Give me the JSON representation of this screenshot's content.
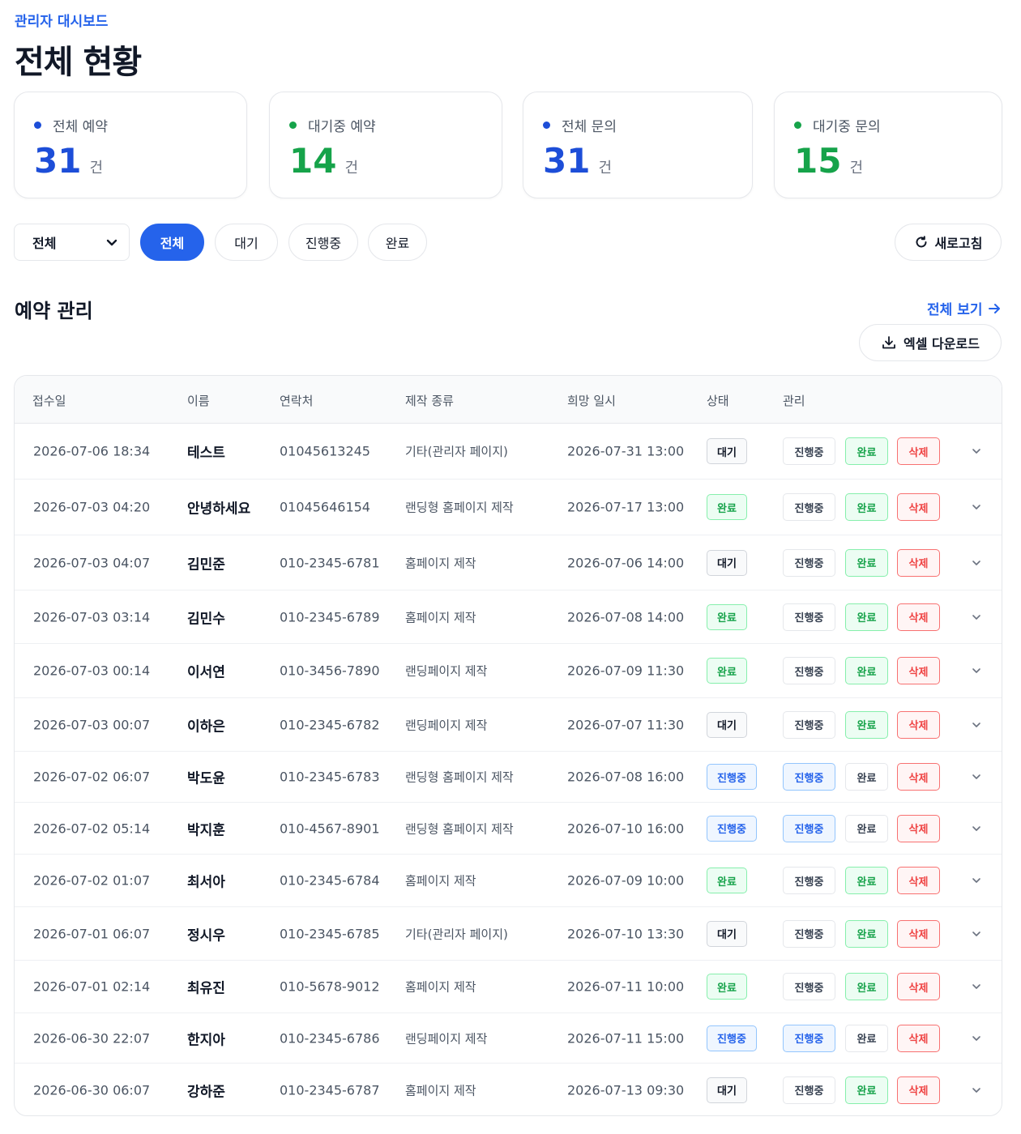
{
  "header": {
    "eyebrow": "관리자 대시보드",
    "title": "전체 현황"
  },
  "stats": [
    {
      "label": "전체 예약",
      "value": "31",
      "unit": "건",
      "color": "#1d4ed8"
    },
    {
      "label": "대기중 예약",
      "value": "14",
      "unit": "건",
      "color": "#16a34a"
    },
    {
      "label": "전체 문의",
      "value": "31",
      "unit": "건",
      "color": "#1d4ed8"
    },
    {
      "label": "대기중 문의",
      "value": "15",
      "unit": "건",
      "color": "#16a34a"
    }
  ],
  "filters": {
    "select_value": "전체",
    "pills": [
      "전체",
      "대기",
      "진행중",
      "완료"
    ],
    "active_pill": "전체",
    "refresh_label": "새로고침"
  },
  "section": {
    "title": "예약 관리",
    "view_all": "전체 보기",
    "excel_label": "엑셀 다운로드"
  },
  "table": {
    "columns": [
      "접수일",
      "이름",
      "연락처",
      "제작 종류",
      "희망 일시",
      "상태",
      "관리"
    ],
    "actions": {
      "progress": "진행중",
      "done": "완료",
      "delete": "삭제"
    },
    "rows": [
      {
        "date": "2026-07-06 18:34",
        "name": "테스트",
        "phone": "01045613245",
        "type": "기타(관리자 페이지)",
        "wish": "2026-07-31 13:00",
        "status": "대기",
        "status_key": "wait"
      },
      {
        "date": "2026-07-03 04:20",
        "name": "안녕하세요",
        "phone": "01045646154",
        "type": "랜딩형 홈페이지 제작",
        "wish": "2026-07-17 13:00",
        "status": "완료",
        "status_key": "done"
      },
      {
        "date": "2026-07-03 04:07",
        "name": "김민준",
        "phone": "010-2345-6781",
        "type": "홈페이지 제작",
        "wish": "2026-07-06 14:00",
        "status": "대기",
        "status_key": "wait"
      },
      {
        "date": "2026-07-03 03:14",
        "name": "김민수",
        "phone": "010-2345-6789",
        "type": "홈페이지 제작",
        "wish": "2026-07-08 14:00",
        "status": "완료",
        "status_key": "done"
      },
      {
        "date": "2026-07-03 00:14",
        "name": "이서연",
        "phone": "010-3456-7890",
        "type": "랜딩페이지 제작",
        "wish": "2026-07-09 11:30",
        "status": "완료",
        "status_key": "done"
      },
      {
        "date": "2026-07-03 00:07",
        "name": "이하은",
        "phone": "010-2345-6782",
        "type": "랜딩페이지 제작",
        "wish": "2026-07-07 11:30",
        "status": "대기",
        "status_key": "wait"
      },
      {
        "date": "2026-07-02 06:07",
        "name": "박도윤",
        "phone": "010-2345-6783",
        "type": "랜딩형 홈페이지 제작",
        "wish": "2026-07-08 16:00",
        "status": "진행중",
        "status_key": "prog"
      },
      {
        "date": "2026-07-02 05:14",
        "name": "박지훈",
        "phone": "010-4567-8901",
        "type": "랜딩형 홈페이지 제작",
        "wish": "2026-07-10 16:00",
        "status": "진행중",
        "status_key": "prog"
      },
      {
        "date": "2026-07-02 01:07",
        "name": "최서아",
        "phone": "010-2345-6784",
        "type": "홈페이지 제작",
        "wish": "2026-07-09 10:00",
        "status": "완료",
        "status_key": "done"
      },
      {
        "date": "2026-07-01 06:07",
        "name": "정시우",
        "phone": "010-2345-6785",
        "type": "기타(관리자 페이지)",
        "wish": "2026-07-10 13:30",
        "status": "대기",
        "status_key": "wait"
      },
      {
        "date": "2026-07-01 02:14",
        "name": "최유진",
        "phone": "010-5678-9012",
        "type": "홈페이지 제작",
        "wish": "2026-07-11 10:00",
        "status": "완료",
        "status_key": "done"
      },
      {
        "date": "2026-06-30 22:07",
        "name": "한지아",
        "phone": "010-2345-6786",
        "type": "랜딩페이지 제작",
        "wish": "2026-07-11 15:00",
        "status": "진행중",
        "status_key": "prog"
      },
      {
        "date": "2026-06-30 06:07",
        "name": "강하준",
        "phone": "010-2345-6787",
        "type": "홈페이지 제작",
        "wish": "2026-07-13 09:30",
        "status": "대기",
        "status_key": "wait"
      }
    ]
  }
}
